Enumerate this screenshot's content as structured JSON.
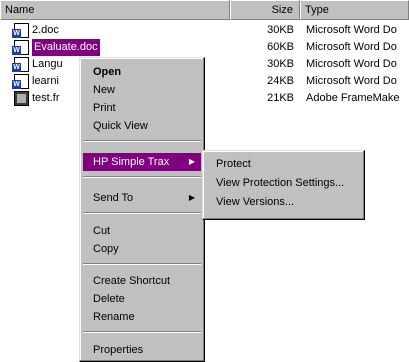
{
  "columns": {
    "name": "Name",
    "size": "Size",
    "type": "Type"
  },
  "files": [
    {
      "name": "2.doc",
      "size": "30KB",
      "type": "Microsoft Word Do",
      "icon": "word-doc-icon"
    },
    {
      "name": "Evaluate.doc",
      "size": "60KB",
      "type": "Microsoft Word Do",
      "icon": "word-doc-icon",
      "selected": true
    },
    {
      "name": "Langu",
      "size": "30KB",
      "type": "Microsoft Word Do",
      "icon": "word-doc-icon"
    },
    {
      "name": "learni",
      "size": "24KB",
      "type": "Microsoft Word Do",
      "icon": "word-doc-icon"
    },
    {
      "name": "test.fr",
      "size": "21KB",
      "type": "Adobe FrameMake",
      "icon": "framemaker-doc-icon"
    }
  ],
  "context_menu": {
    "open": "Open",
    "new": "New",
    "print": "Print",
    "quick_view": "Quick View",
    "hp_simple_trax": "HP Simple Trax",
    "send_to": "Send To",
    "cut": "Cut",
    "copy": "Copy",
    "create_shortcut": "Create Shortcut",
    "delete": "Delete",
    "rename": "Rename",
    "properties": "Properties"
  },
  "submenu": {
    "protect": "Protect",
    "view_protection_settings": "View Protection Settings...",
    "view_versions": "View Versions..."
  },
  "colors": {
    "highlight": "#800080",
    "menu_bg": "#c0c0c0"
  }
}
